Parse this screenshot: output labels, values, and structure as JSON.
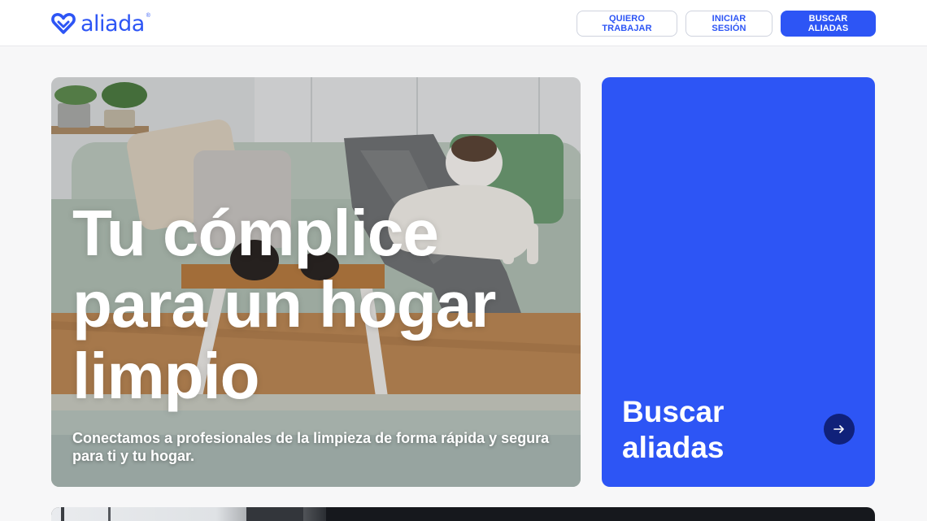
{
  "header": {
    "logo_text": "aliada",
    "logo_registered": "®",
    "nav": {
      "work_label": "QUIERO TRABAJAR",
      "login_label": "INICIAR SESIÓN",
      "search_label": "BUSCAR ALIADAS"
    }
  },
  "hero": {
    "title": "Tu cómplice\npara un hogar\nlimpio",
    "subtitle": "Conectamos a profesionales de la limpieza de forma rápida y segura para ti y tu hogar."
  },
  "search_card": {
    "title": "Buscar\naliadas",
    "arrow_icon": "arrow-right-icon"
  },
  "colors": {
    "brand": "#2d55f5",
    "brand_dark": "#10217a",
    "background": "#f7f7f8"
  }
}
